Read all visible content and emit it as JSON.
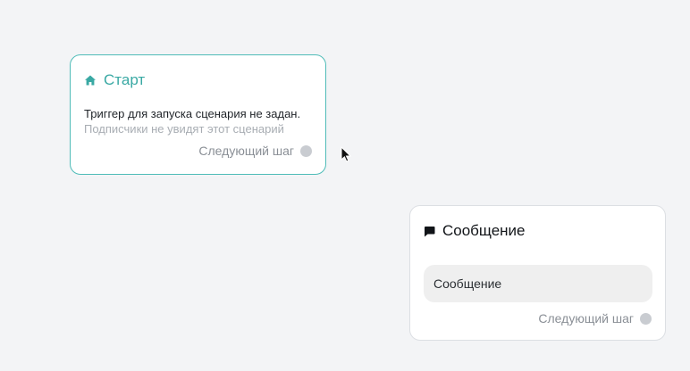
{
  "start_node": {
    "icon": "home-icon",
    "title": "Старт",
    "description": "Триггер для запуска сценария не задан.",
    "subdescription": "Подписчики не увидят этот сценарий",
    "next_step_label": "Следующий шаг",
    "accent_color": "#3aa9a4"
  },
  "message_node": {
    "icon": "chat-bubble-icon",
    "title": "Сообщение",
    "message_text": "Сообщение",
    "next_step_label": "Следующий шаг"
  },
  "cursor": {
    "icon": "arrow-cursor-icon"
  }
}
